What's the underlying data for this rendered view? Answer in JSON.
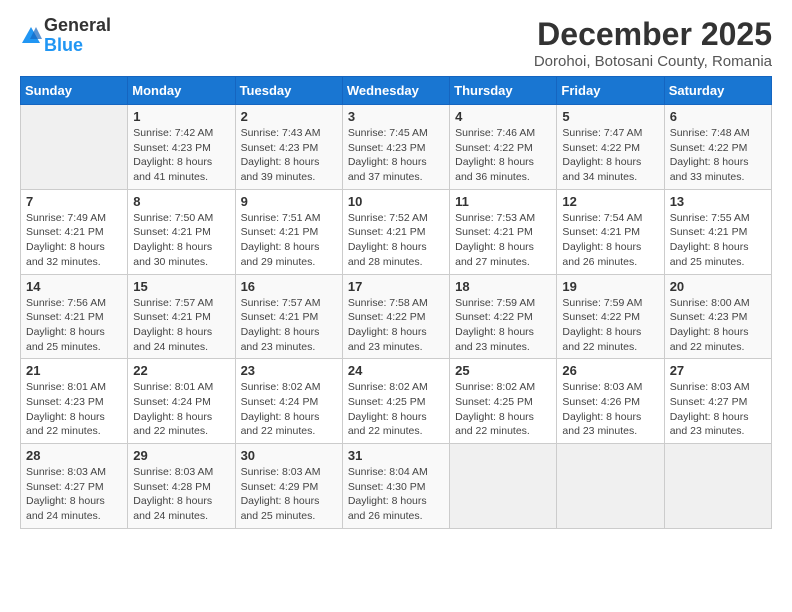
{
  "logo": {
    "general": "General",
    "blue": "Blue"
  },
  "title": "December 2025",
  "subtitle": "Dorohoi, Botosani County, Romania",
  "days_header": [
    "Sunday",
    "Monday",
    "Tuesday",
    "Wednesday",
    "Thursday",
    "Friday",
    "Saturday"
  ],
  "weeks": [
    [
      {
        "day": "",
        "info": ""
      },
      {
        "day": "1",
        "info": "Sunrise: 7:42 AM\nSunset: 4:23 PM\nDaylight: 8 hours\nand 41 minutes."
      },
      {
        "day": "2",
        "info": "Sunrise: 7:43 AM\nSunset: 4:23 PM\nDaylight: 8 hours\nand 39 minutes."
      },
      {
        "day": "3",
        "info": "Sunrise: 7:45 AM\nSunset: 4:23 PM\nDaylight: 8 hours\nand 37 minutes."
      },
      {
        "day": "4",
        "info": "Sunrise: 7:46 AM\nSunset: 4:22 PM\nDaylight: 8 hours\nand 36 minutes."
      },
      {
        "day": "5",
        "info": "Sunrise: 7:47 AM\nSunset: 4:22 PM\nDaylight: 8 hours\nand 34 minutes."
      },
      {
        "day": "6",
        "info": "Sunrise: 7:48 AM\nSunset: 4:22 PM\nDaylight: 8 hours\nand 33 minutes."
      }
    ],
    [
      {
        "day": "7",
        "info": "Sunrise: 7:49 AM\nSunset: 4:21 PM\nDaylight: 8 hours\nand 32 minutes."
      },
      {
        "day": "8",
        "info": "Sunrise: 7:50 AM\nSunset: 4:21 PM\nDaylight: 8 hours\nand 30 minutes."
      },
      {
        "day": "9",
        "info": "Sunrise: 7:51 AM\nSunset: 4:21 PM\nDaylight: 8 hours\nand 29 minutes."
      },
      {
        "day": "10",
        "info": "Sunrise: 7:52 AM\nSunset: 4:21 PM\nDaylight: 8 hours\nand 28 minutes."
      },
      {
        "day": "11",
        "info": "Sunrise: 7:53 AM\nSunset: 4:21 PM\nDaylight: 8 hours\nand 27 minutes."
      },
      {
        "day": "12",
        "info": "Sunrise: 7:54 AM\nSunset: 4:21 PM\nDaylight: 8 hours\nand 26 minutes."
      },
      {
        "day": "13",
        "info": "Sunrise: 7:55 AM\nSunset: 4:21 PM\nDaylight: 8 hours\nand 25 minutes."
      }
    ],
    [
      {
        "day": "14",
        "info": "Sunrise: 7:56 AM\nSunset: 4:21 PM\nDaylight: 8 hours\nand 25 minutes."
      },
      {
        "day": "15",
        "info": "Sunrise: 7:57 AM\nSunset: 4:21 PM\nDaylight: 8 hours\nand 24 minutes."
      },
      {
        "day": "16",
        "info": "Sunrise: 7:57 AM\nSunset: 4:21 PM\nDaylight: 8 hours\nand 23 minutes."
      },
      {
        "day": "17",
        "info": "Sunrise: 7:58 AM\nSunset: 4:22 PM\nDaylight: 8 hours\nand 23 minutes."
      },
      {
        "day": "18",
        "info": "Sunrise: 7:59 AM\nSunset: 4:22 PM\nDaylight: 8 hours\nand 23 minutes."
      },
      {
        "day": "19",
        "info": "Sunrise: 7:59 AM\nSunset: 4:22 PM\nDaylight: 8 hours\nand 22 minutes."
      },
      {
        "day": "20",
        "info": "Sunrise: 8:00 AM\nSunset: 4:23 PM\nDaylight: 8 hours\nand 22 minutes."
      }
    ],
    [
      {
        "day": "21",
        "info": "Sunrise: 8:01 AM\nSunset: 4:23 PM\nDaylight: 8 hours\nand 22 minutes."
      },
      {
        "day": "22",
        "info": "Sunrise: 8:01 AM\nSunset: 4:24 PM\nDaylight: 8 hours\nand 22 minutes."
      },
      {
        "day": "23",
        "info": "Sunrise: 8:02 AM\nSunset: 4:24 PM\nDaylight: 8 hours\nand 22 minutes."
      },
      {
        "day": "24",
        "info": "Sunrise: 8:02 AM\nSunset: 4:25 PM\nDaylight: 8 hours\nand 22 minutes."
      },
      {
        "day": "25",
        "info": "Sunrise: 8:02 AM\nSunset: 4:25 PM\nDaylight: 8 hours\nand 22 minutes."
      },
      {
        "day": "26",
        "info": "Sunrise: 8:03 AM\nSunset: 4:26 PM\nDaylight: 8 hours\nand 23 minutes."
      },
      {
        "day": "27",
        "info": "Sunrise: 8:03 AM\nSunset: 4:27 PM\nDaylight: 8 hours\nand 23 minutes."
      }
    ],
    [
      {
        "day": "28",
        "info": "Sunrise: 8:03 AM\nSunset: 4:27 PM\nDaylight: 8 hours\nand 24 minutes."
      },
      {
        "day": "29",
        "info": "Sunrise: 8:03 AM\nSunset: 4:28 PM\nDaylight: 8 hours\nand 24 minutes."
      },
      {
        "day": "30",
        "info": "Sunrise: 8:03 AM\nSunset: 4:29 PM\nDaylight: 8 hours\nand 25 minutes."
      },
      {
        "day": "31",
        "info": "Sunrise: 8:04 AM\nSunset: 4:30 PM\nDaylight: 8 hours\nand 26 minutes."
      },
      {
        "day": "",
        "info": ""
      },
      {
        "day": "",
        "info": ""
      },
      {
        "day": "",
        "info": ""
      }
    ]
  ]
}
